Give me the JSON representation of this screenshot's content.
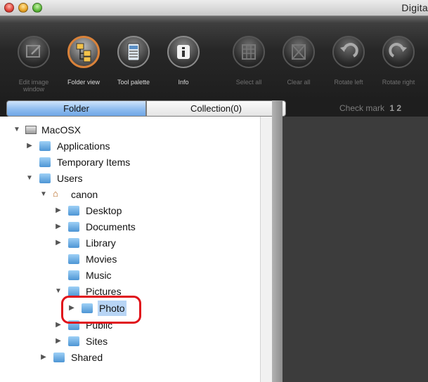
{
  "window": {
    "title": "Digita"
  },
  "toolbar": {
    "items": [
      {
        "label": "Edit image window",
        "icon": "edit-icon",
        "state": "dim"
      },
      {
        "label": "Folder view",
        "icon": "folder-view-icon",
        "state": "active"
      },
      {
        "label": "Tool palette",
        "icon": "palette-icon",
        "state": "normal"
      },
      {
        "label": "Info",
        "icon": "info-icon",
        "state": "normal"
      },
      {
        "label": "Select all",
        "icon": "select-all-icon",
        "state": "dim"
      },
      {
        "label": "Clear all",
        "icon": "clear-all-icon",
        "state": "dim"
      },
      {
        "label": "Rotate left",
        "icon": "rotate-left-icon",
        "state": "dim"
      },
      {
        "label": "Rotate right",
        "icon": "rotate-right-icon",
        "state": "dim"
      }
    ]
  },
  "tabs": {
    "folder": "Folder",
    "collection": "Collection(0)"
  },
  "check_mark": {
    "label": "Check mark",
    "numbers": "1 2"
  },
  "tree": [
    {
      "label": "MacOSX",
      "icon": "drive-icon",
      "expand": "open"
    },
    {
      "label": "Applications",
      "icon": "folder-icon",
      "expand": "closed"
    },
    {
      "label": "Temporary Items",
      "icon": "folder-icon",
      "expand": "none"
    },
    {
      "label": "Users",
      "icon": "folder-icon",
      "expand": "open"
    },
    {
      "label": "canon",
      "icon": "home-icon",
      "expand": "open"
    },
    {
      "label": "Desktop",
      "icon": "folder-icon",
      "expand": "closed"
    },
    {
      "label": "Documents",
      "icon": "folder-icon",
      "expand": "closed"
    },
    {
      "label": "Library",
      "icon": "folder-icon",
      "expand": "closed"
    },
    {
      "label": "Movies",
      "icon": "folder-icon",
      "expand": "none"
    },
    {
      "label": "Music",
      "icon": "folder-icon",
      "expand": "none"
    },
    {
      "label": "Pictures",
      "icon": "folder-icon",
      "expand": "open"
    },
    {
      "label": "Photo",
      "icon": "folder-icon",
      "expand": "closed",
      "selected": true
    },
    {
      "label": "Public",
      "icon": "folder-icon",
      "expand": "closed"
    },
    {
      "label": "Sites",
      "icon": "folder-icon",
      "expand": "closed"
    },
    {
      "label": "Shared",
      "icon": "folder-icon",
      "expand": "closed"
    }
  ],
  "colors": {
    "accent": "#d9823a",
    "selection": "#b8d5f5",
    "callout": "#e0131b"
  }
}
